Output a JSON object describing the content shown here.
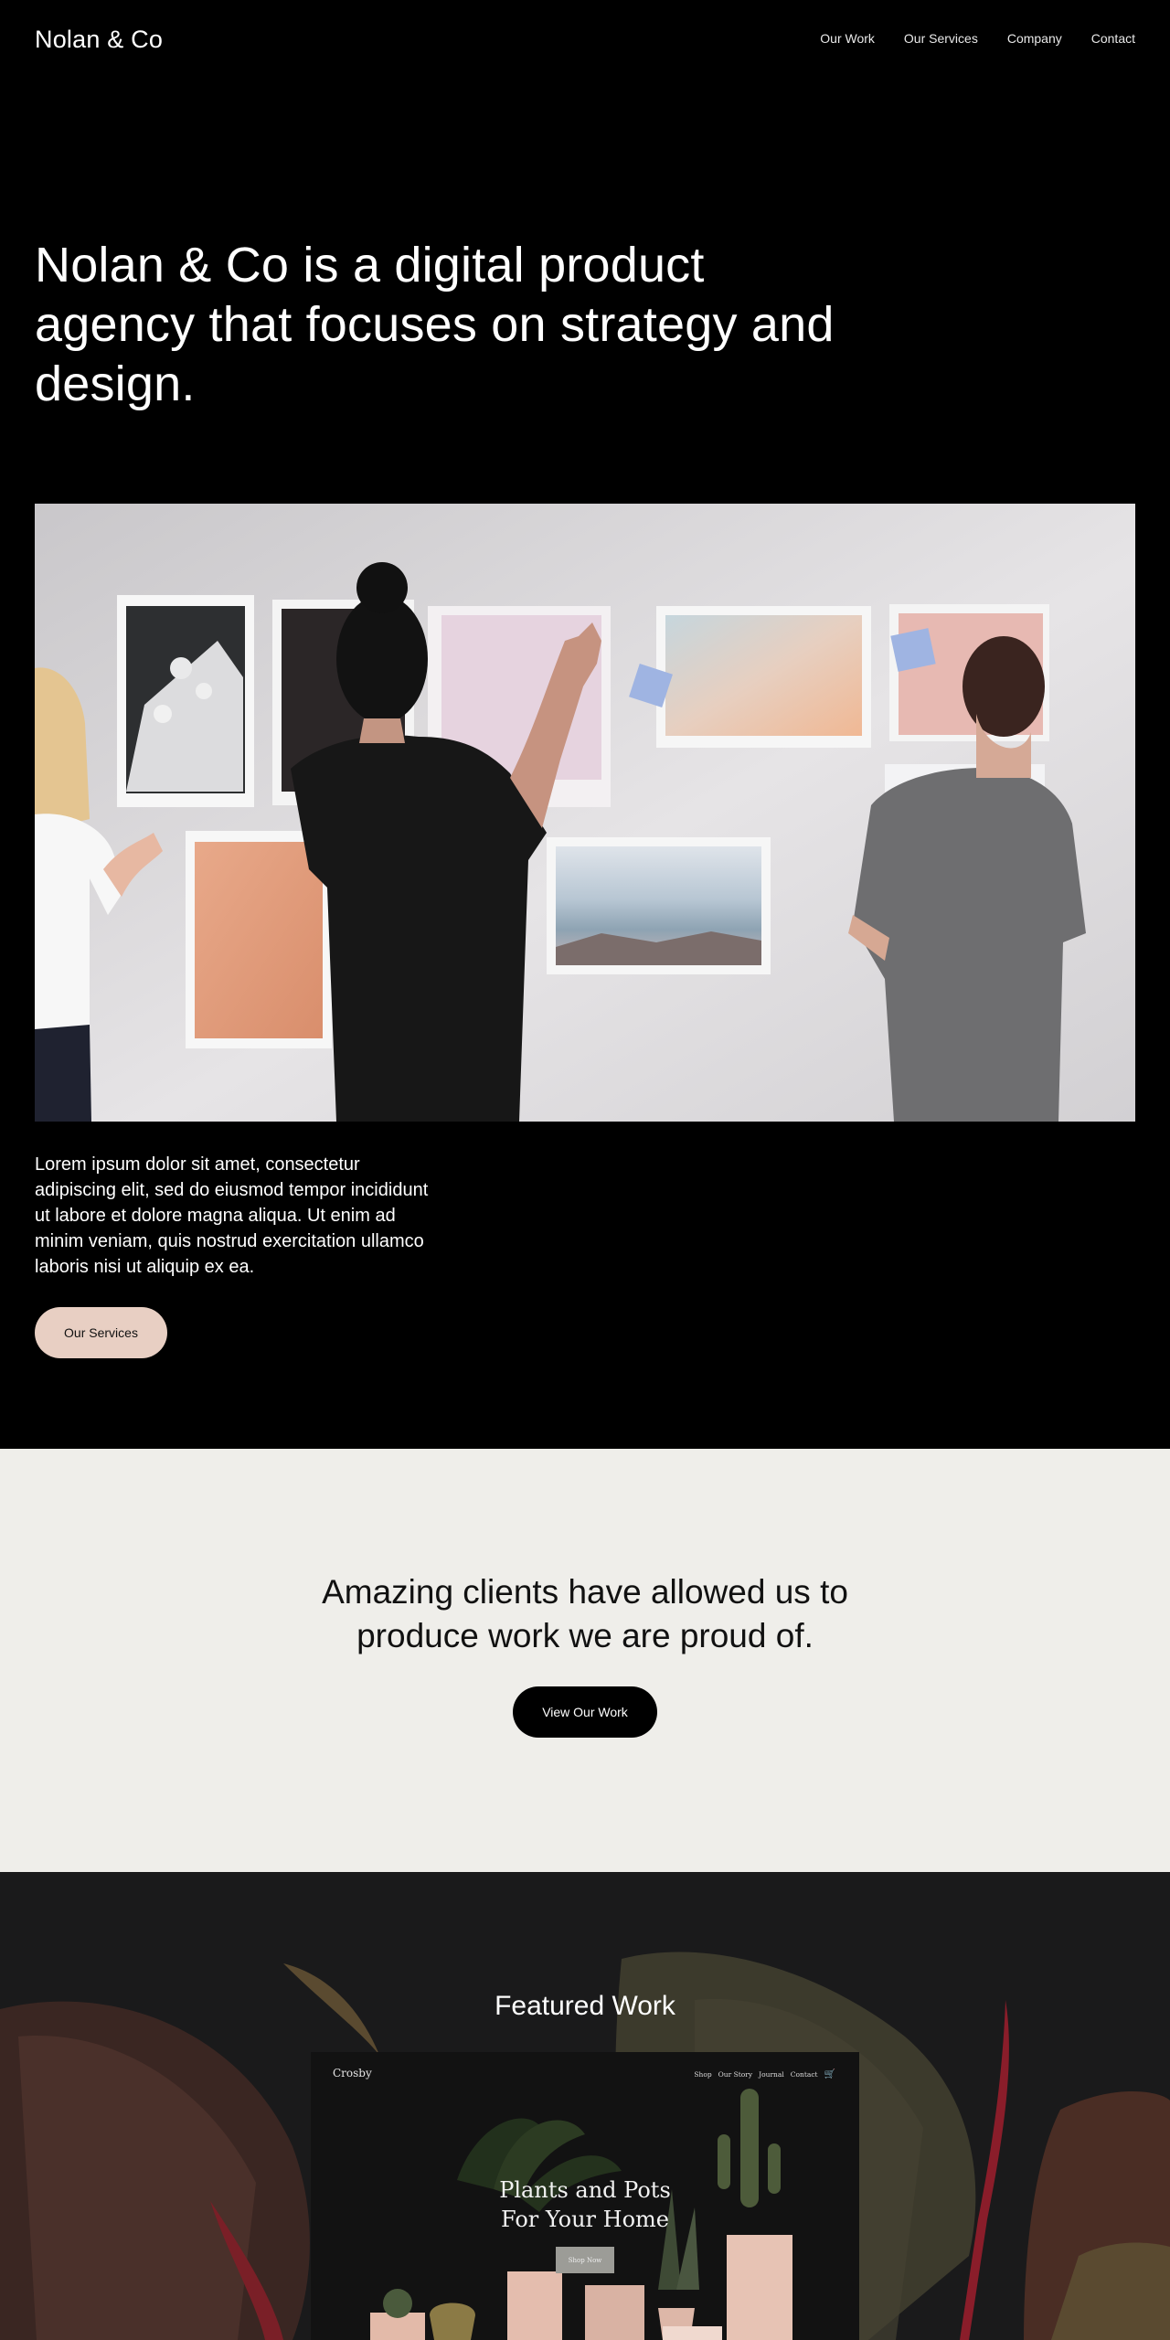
{
  "header": {
    "logo": "Nolan & Co",
    "nav": [
      "Our Work",
      "Our Services",
      "Company",
      "Contact"
    ]
  },
  "hero": {
    "heading_lines": [
      "Nolan & Co is a digital product",
      "agency that focuses on strategy and",
      "design."
    ],
    "intro_lines": [
      "Lorem ipsum dolor sit amet, consectetur",
      "adipiscing elit, sed do eiusmod tempor incididunt",
      "ut labore et dolore magna aliqua. Ut enim ad",
      "minim veniam, quis nostrud exercitation ullamco",
      "laboris nisi ut aliquip ex ea."
    ],
    "button": "Our Services"
  },
  "clients": {
    "heading_lines": [
      "Amazing clients have allowed us to",
      "produce work we are proud of."
    ],
    "button": "View Our Work"
  },
  "featured": {
    "title": "Featured Work",
    "mockup": {
      "logo": "Crosby",
      "nav": [
        "Shop",
        "Our Story",
        "Journal",
        "Contact"
      ],
      "title_lines": [
        "Plants and Pots",
        "For Your Home"
      ],
      "button": "Shop Now"
    }
  },
  "colors": {
    "background": "#000000",
    "accent_button": "#e8cfc3",
    "clients_background": "#efeeea",
    "featured_background": "#1a1a1b"
  },
  "icons": [
    "cart-icon"
  ]
}
